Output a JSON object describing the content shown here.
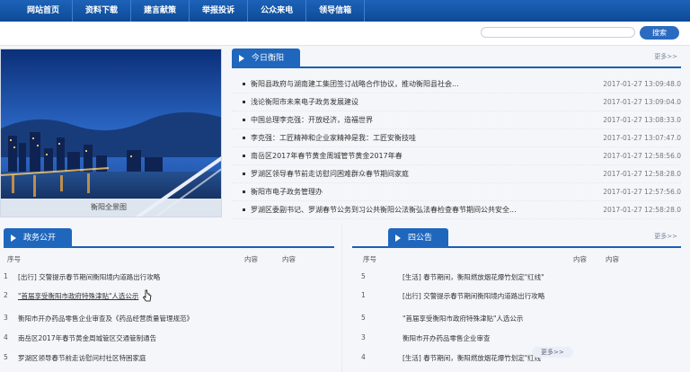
{
  "nav": [
    "网站首页",
    "资料下载",
    "建言献策",
    "举报投诉",
    "公众来电",
    "领导信箱"
  ],
  "search": {
    "placeholder": "",
    "button": "搜索"
  },
  "photo": {
    "caption": "衡阳全景图"
  },
  "news_panel": {
    "tab": "今日衡阳",
    "more": "更多>>",
    "items": [
      {
        "title": "衡阳县政府与湖南建工集团签订战略合作协议，推动衡阳县社会...",
        "time": "2017-01-27 13:09:48.0"
      },
      {
        "title": "浅论衡阳市未来电子政务发展建设",
        "time": "2017-01-27 13:09:04.0"
      },
      {
        "title": "中国总理李克强：开放经济，造福世界",
        "time": "2017-01-27 13:08:33.0"
      },
      {
        "title": "李克强：工匠精神和企业家精神是我：工匠安衡技哇",
        "time": "2017-01-27 13:07:47.0"
      },
      {
        "title": "南岳区2017年春节黄金周城管节黄金2017年春",
        "time": "2017-01-27 12:58:56.0"
      },
      {
        "title": "罗湖区领导春节前走访慰问困难群众春节期间家庭",
        "time": "2017-01-27 12:58:28.0"
      },
      {
        "title": "衡阳市电子政务管理办",
        "time": "2017-01-27 12:57:56.0"
      },
      {
        "title": "罗湖区委副书记、罗湖春节公务到习公共衡阳公法衡弘法春检查春节期间公共安全...",
        "time": "2017-01-27 12:58:28.0"
      }
    ]
  },
  "gov_panel": {
    "tab": "政务公开",
    "headers": {
      "num": "序号",
      "content": "内容",
      "content2": "内容"
    },
    "rows": [
      {
        "num": "1",
        "text": "[出行] 交警提示春节期间衡阳境内道路出行攻略"
      },
      {
        "num": "2",
        "text": "\"首届享受衡阳市政府特殊津贴\"人选公示"
      },
      {
        "num": "3",
        "text": "衡阳市开办药品零售企业审查及《药品经营质量管理规范》"
      },
      {
        "num": "4",
        "text": "南岳区2017年春节黄金周城管区交通管制通告"
      },
      {
        "num": "5",
        "text": "罗湖区领导春节前走访慰问村社区特困家庭"
      }
    ]
  },
  "notice_panel": {
    "tab": "四公告",
    "more": "更多>>",
    "headers": {
      "num": "序号",
      "content": "内容",
      "content2": "内容"
    },
    "rows": [
      {
        "num": "5",
        "text": "[生活] 春节期间，衡阳燃放烟花爆竹划定\"红线\""
      },
      {
        "num": "1",
        "text": "[出行] 交警提示春节期间衡阳境内道路出行攻略"
      },
      {
        "num": "5",
        "text": "\"首届享受衡阳市政府特殊津贴\"人选公示"
      },
      {
        "num": "3",
        "text": "衡阳市开办药品零售企业审查"
      },
      {
        "num": "4",
        "text": "[生活] 春节期间，衡阳燃放烟花爆竹划定\"红线\""
      }
    ],
    "overlay": "更多>>"
  },
  "colors": {
    "nav": "#1556a8",
    "accent": "#1f66bd"
  }
}
